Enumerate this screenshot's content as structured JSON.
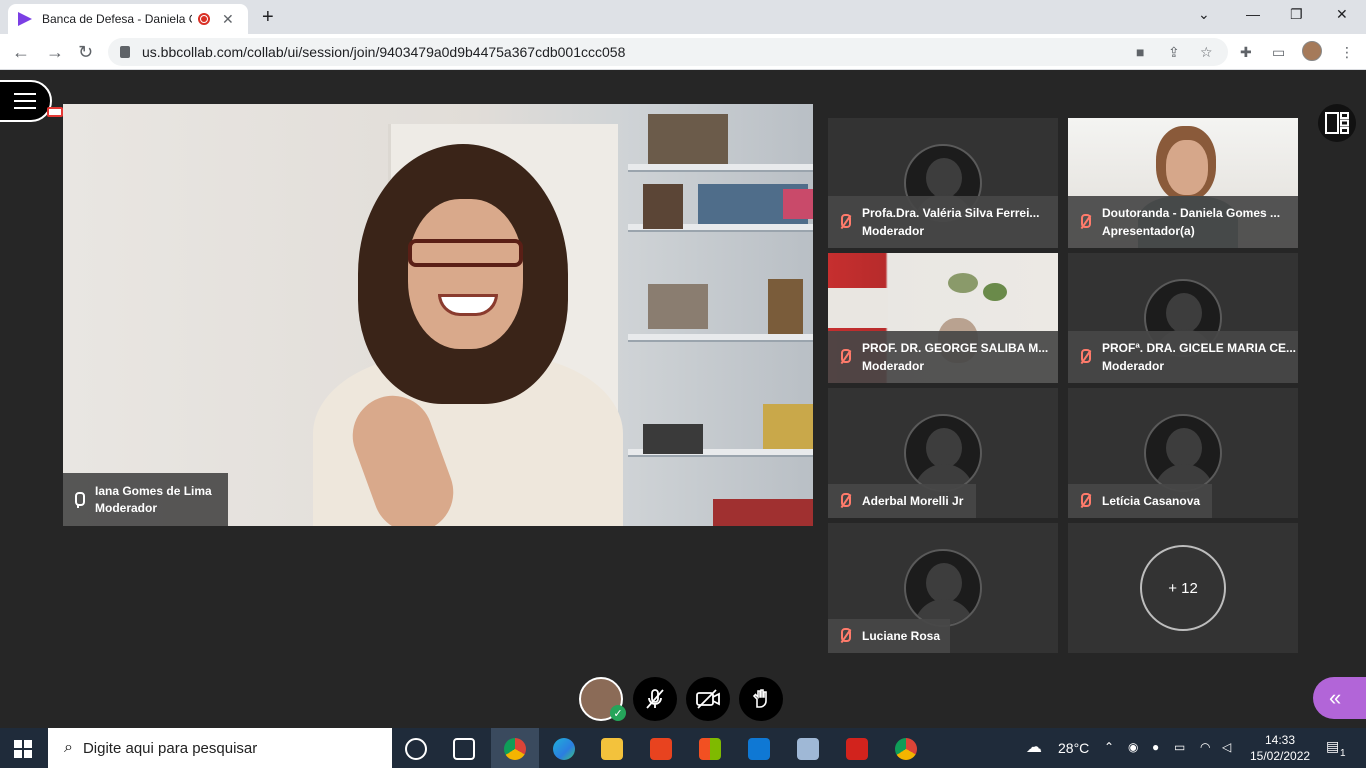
{
  "browser": {
    "tab_title": "Banca de Defesa - Daniela G",
    "url": "us.bbcollab.com/collab/ui/session/join/9403479a0d9b4475a367cdb001ccc058"
  },
  "main_speaker": {
    "name": "Iana Gomes de Lima",
    "role": "Moderador"
  },
  "participants": [
    {
      "name": "Profa.Dra. Valéria Silva Ferrei...",
      "role": "Moderador"
    },
    {
      "name": "Doutoranda - Daniela Gomes ...",
      "role": "Apresentador(a)"
    },
    {
      "name": "PROF. DR. GEORGE SALIBA M...",
      "role": "Moderador"
    },
    {
      "name": "PROFª. DRA. GICELE MARIA CE...",
      "role": "Moderador"
    },
    {
      "name": "Aderbal Morelli Jr",
      "role": ""
    },
    {
      "name": "Letícia Casanova",
      "role": ""
    },
    {
      "name": "Luciane Rosa",
      "role": ""
    }
  ],
  "more_participants": "+ 12",
  "taskbar": {
    "search_placeholder": "Digite aqui para pesquisar",
    "temperature": "28°C",
    "time": "14:33",
    "date": "15/02/2022",
    "notifications": "1"
  },
  "colors": {
    "accent_purple": "#b265d8",
    "muted_red": "#ff7b6b",
    "app_bg": "#262626"
  }
}
